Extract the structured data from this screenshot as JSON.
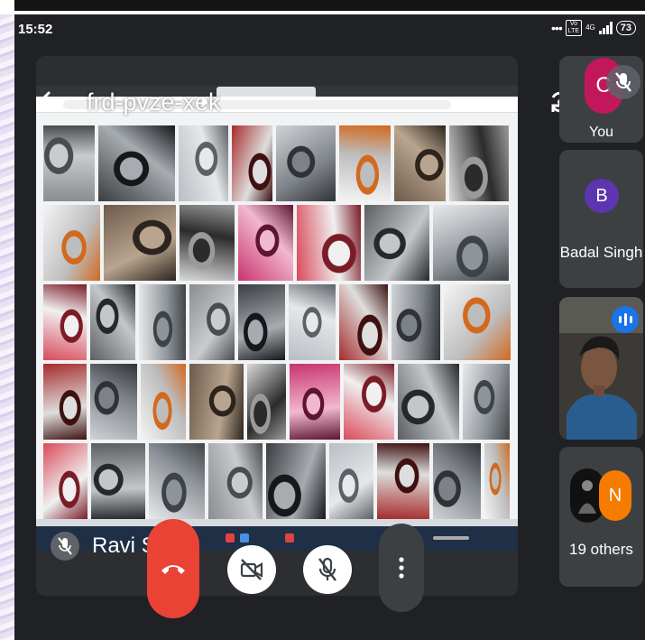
{
  "status_bar": {
    "time": "15:52",
    "battery": "73",
    "network": "4G",
    "volte": "Vo LTE"
  },
  "meeting": {
    "code": "frd-pvze-xek",
    "presenter_name": "Ravi Sy"
  },
  "participants": [
    {
      "name": "You",
      "initial": "C",
      "muted": true,
      "avatar_color": "#c2185b"
    },
    {
      "name": "Badal Singh",
      "initial": "B",
      "avatar_color": "#5e35b1"
    },
    {
      "name": "",
      "has_camera": true,
      "speaking": true
    },
    {
      "name": "19 others",
      "initial": "N",
      "avatar_color": "#f57c00"
    }
  ],
  "controls": [
    {
      "id": "hangup",
      "icon": "call-end-icon"
    },
    {
      "id": "camera",
      "icon": "videocam-off-icon"
    },
    {
      "id": "microphone",
      "icon": "mic-off-icon"
    },
    {
      "id": "more",
      "icon": "more-vert-icon"
    }
  ],
  "colors": {
    "background": "#202124",
    "tile": "#3c4043",
    "hangup": "#ea4335",
    "speaking": "#1a73e8"
  },
  "shared_screen": {
    "description_tiles": [
      "exhaust-tip",
      "supercar-rear",
      "exhaust-tip",
      "muffler",
      "red-car",
      "exhaust-pipe",
      "exhaust-system",
      "exhaust-tip",
      "dual-exhaust",
      "pink-car",
      "red-car-exhaust",
      "undercarriage",
      "quad-exhaust",
      "muffler-diagram"
    ]
  }
}
